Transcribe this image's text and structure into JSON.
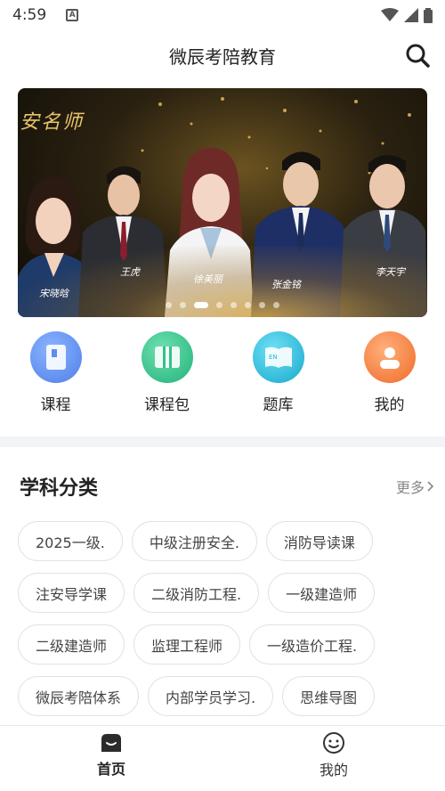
{
  "status": {
    "time": "4:59",
    "notification_icon": "A"
  },
  "header": {
    "title": "微辰考陪教育",
    "search_icon": "search-icon"
  },
  "banner": {
    "title": "安名师",
    "teachers": [
      {
        "name": "宋晓晗"
      },
      {
        "name": "王虎"
      },
      {
        "name": "徐美丽"
      },
      {
        "name": "张金铭"
      },
      {
        "name": "李天宇"
      }
    ],
    "page_count": 8,
    "active_page": 3
  },
  "quick_nav": [
    {
      "label": "课程",
      "icon": "book-icon",
      "color": "#5b8def"
    },
    {
      "label": "课程包",
      "icon": "package-icon",
      "color": "#34c18a"
    },
    {
      "label": "题库",
      "icon": "question-bank-icon",
      "color": "#22b8d6"
    },
    {
      "label": "我的",
      "icon": "user-icon",
      "color": "#f5813a"
    }
  ],
  "subjects": {
    "title": "学科分类",
    "more_label": "更多",
    "tags": [
      [
        "2025一级.",
        "中级注册安全.",
        "消防导读课"
      ],
      [
        "注安导学课",
        "二级消防工程.",
        "一级建造师"
      ],
      [
        "二级建造师",
        "监理工程师",
        "一级造价工程."
      ],
      [
        "微辰考陪体系",
        "内部学员学习.",
        "思维导图"
      ]
    ]
  },
  "bottom_nav": [
    {
      "label": "首页",
      "icon": "home-icon",
      "active": true
    },
    {
      "label": "我的",
      "icon": "smiley-icon",
      "active": false
    }
  ]
}
